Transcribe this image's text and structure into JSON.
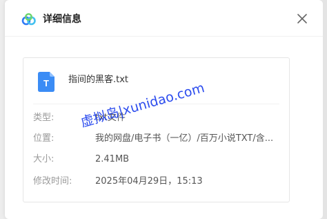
{
  "dialog": {
    "title": "详细信息",
    "close_glyph": "✕",
    "logo_icon": "baidu-netdisk-logo-icon"
  },
  "file": {
    "name": "指间的黑客.txt",
    "icon": "txt-file-icon",
    "icon_letter": "T",
    "icon_color": "#3b8cf5"
  },
  "details": [
    {
      "label": "类型:",
      "value": "txt文件"
    },
    {
      "label": "位置:",
      "value": "我的网盘/电子书（一亿）/百万小说TXT/含..."
    },
    {
      "label": "大小:",
      "value": "2.41MB"
    },
    {
      "label": "修改时间:",
      "value": "2025年04月29日，15:13"
    }
  ],
  "watermark": "虚拟岛|xunidao.com",
  "colors": {
    "watermark": "#2244ee",
    "label": "#9a9a9a",
    "value": "#555555"
  }
}
